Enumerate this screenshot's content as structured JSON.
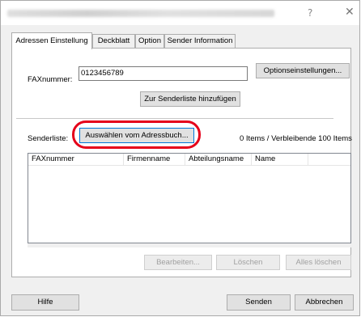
{
  "tabs": [
    {
      "label": "Adressen Einstellung",
      "active": true
    },
    {
      "label": "Deckblatt",
      "active": false
    },
    {
      "label": "Option",
      "active": false
    },
    {
      "label": "Sender Information",
      "active": false
    }
  ],
  "titlebar": {
    "help": "?",
    "close": "✕"
  },
  "fax": {
    "label": "FAXnummer:",
    "value": "0123456789",
    "options_button": "Optionseinstellungen...",
    "add_button": "Zur Senderliste hinzufügen"
  },
  "senderlist": {
    "label": "Senderliste:",
    "select_button": "Auswählen vom Adressbuch...",
    "status": "0 Items / Verbleibende 100 Items",
    "columns": [
      "FAXnummer",
      "Firmenname",
      "Abteilungsname",
      "Name"
    ]
  },
  "actions": {
    "edit": "Bearbeiten...",
    "delete": "Löschen",
    "delete_all": "Alles löschen"
  },
  "footer": {
    "help": "Hilfe",
    "send": "Senden",
    "cancel": "Abbrechen"
  },
  "colors": {
    "highlight": "#e5001a",
    "focus": "#0078d7"
  }
}
